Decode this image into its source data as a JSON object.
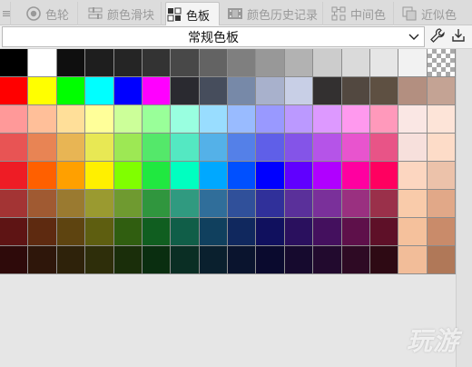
{
  "tabs": [
    {
      "label": "色轮",
      "icon": "color-wheel-icon",
      "active": false
    },
    {
      "label": "颜色滑块",
      "icon": "color-sliders-icon",
      "active": false
    },
    {
      "label": "色板",
      "icon": "swatches-icon",
      "active": true
    },
    {
      "label": "颜色历史记录",
      "icon": "color-history-icon",
      "active": false
    },
    {
      "label": "中间色",
      "icon": "intermediate-color-icon",
      "active": false
    },
    {
      "label": "近似色",
      "icon": "approximate-color-icon",
      "active": false
    }
  ],
  "palette_select": {
    "value": "常规色板"
  },
  "watermark": "玩游",
  "swatch_rows": [
    [
      "#000000",
      "#ffffff",
      "#0f0f0f",
      "#1e1e1e",
      "#252525",
      "#333333",
      "#484848",
      "#636363",
      "#7f7f7f",
      "#989898",
      "#b2b2b2",
      "#cccccc",
      "#dadada",
      "#e6e6e6",
      "#f2f2f2",
      "transparent"
    ],
    [
      "#ff0000",
      "#ffff00",
      "#00ff00",
      "#00ffff",
      "#0000ff",
      "#ff00ff",
      "#2a2a30",
      "#464d5c",
      "#7789a8",
      "#a8b1cc",
      "#c8cfe6",
      "#333030",
      "#524840",
      "#5e5042",
      "#b38f80",
      "#c4a394"
    ],
    [
      "#ff9999",
      "#ffbf99",
      "#ffdf99",
      "#ffff99",
      "#ccff99",
      "#99ff99",
      "#99ffe0",
      "#99ddff",
      "#99bbff",
      "#9999ff",
      "#bb99ff",
      "#dd99ff",
      "#ff99ee",
      "#ff99bb",
      "#fae7e4",
      "#fde4d8"
    ],
    [
      "#e85454",
      "#e88454",
      "#e8b554",
      "#e8e854",
      "#9de854",
      "#54e86a",
      "#54e8c2",
      "#54b1e8",
      "#5480e8",
      "#5f5fe8",
      "#8454e8",
      "#b554e8",
      "#e854ce",
      "#e85487",
      "#f7e0dc",
      "#fddcc8"
    ],
    [
      "#ee1c25",
      "#ff6000",
      "#ffa000",
      "#fff000",
      "#80ff00",
      "#20e840",
      "#00ffc0",
      "#00a8ff",
      "#0050ff",
      "#0000ff",
      "#6000ff",
      "#b000ff",
      "#ff00a0",
      "#ff0060",
      "#fcd6c0",
      "#ecc2aa"
    ],
    [
      "#a33434",
      "#a05a32",
      "#9a7a30",
      "#9a9a30",
      "#6f9a30",
      "#30963e",
      "#309a80",
      "#306e9a",
      "#30509a",
      "#30309a",
      "#5a309a",
      "#7a309a",
      "#9a3080",
      "#9a304a",
      "#f9cbaa",
      "#e1a888"
    ],
    [
      "#5e1414",
      "#5e2a10",
      "#5e4410",
      "#5e5e10",
      "#305e10",
      "#105e20",
      "#105e48",
      "#10405e",
      "#10285e",
      "#10105e",
      "#2a105e",
      "#44105e",
      "#5e104a",
      "#5e1028",
      "#f5c19c",
      "#c98b6a"
    ],
    [
      "#2e0a0a",
      "#2e160a",
      "#2e220a",
      "#2e2e0a",
      "#1a2e0a",
      "#0a2e10",
      "#0a2e24",
      "#0a202e",
      "#0a142e",
      "#0a0a2e",
      "#160a2e",
      "#220a2e",
      "#2e0a24",
      "#2e0a14",
      "#f2bd99",
      "#b07858"
    ]
  ]
}
